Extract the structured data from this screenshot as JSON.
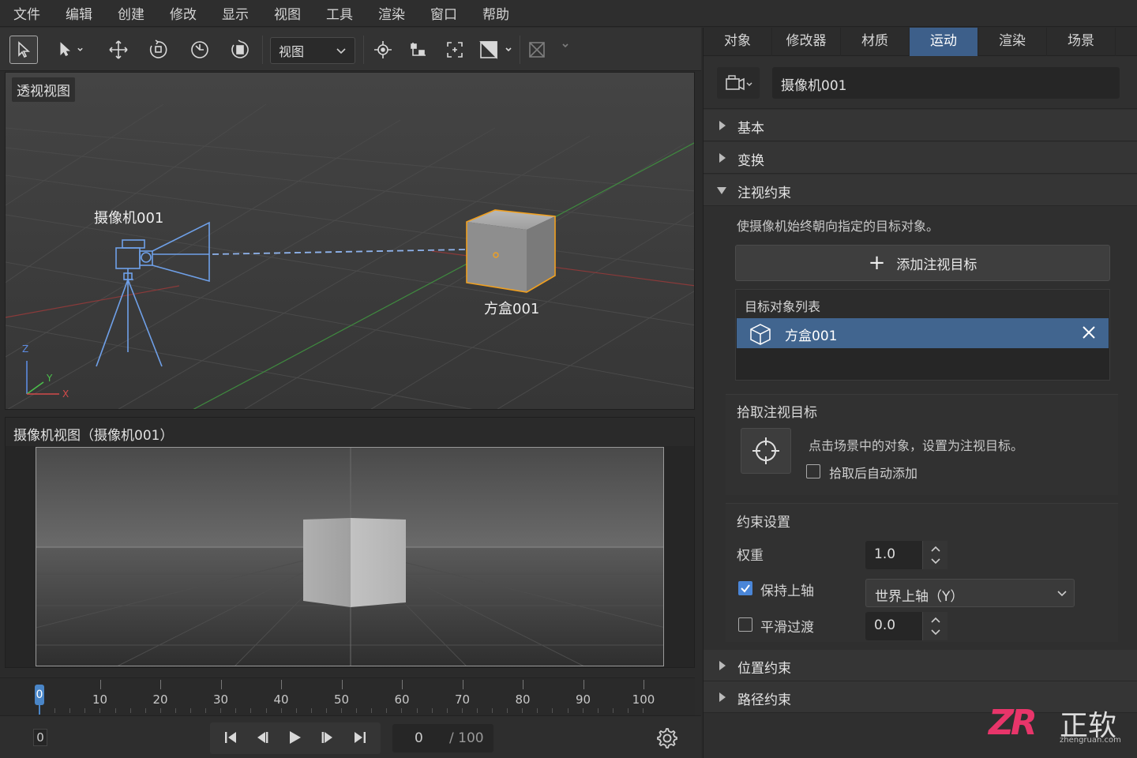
{
  "menu": [
    "文件",
    "编辑",
    "创建",
    "修改",
    "显示",
    "视图",
    "工具",
    "渲染",
    "窗口",
    "帮助"
  ],
  "toolbar": {
    "tools": [
      "select-icon",
      "select-pointer-icon",
      "move-icon",
      "rotate-icon",
      "scale-icon",
      "reset-icon",
      "snap-icon",
      "pivot-icon",
      "fit-icon",
      "shading-icon",
      "maximize-icon"
    ],
    "view_select": "视图"
  },
  "viewport": {
    "persp_label": "透视视图",
    "camera_label": "摄像机001",
    "box_label": "方盒001",
    "axis_labels": {
      "z": "Z",
      "y": "Y",
      "x": "X"
    }
  },
  "camview": {
    "title": "摄像机视图（摄像机001）"
  },
  "timeline": {
    "ticks": [
      "10",
      "20",
      "30",
      "40",
      "50",
      "60",
      "70",
      "80",
      "90",
      "100"
    ],
    "playhead": "0",
    "frame_small": "0",
    "current_frame": "0",
    "total_frames": "/ 100"
  },
  "panel": {
    "tabs": [
      "对象",
      "修改器",
      "材质",
      "运动",
      "渲染",
      "场景"
    ],
    "active_tab": "运动",
    "object_name": "摄像机001",
    "sections": {
      "basic": "基本",
      "transform": "变换",
      "lookat": "注视约束",
      "position": "位置约束",
      "path": "路径约束"
    },
    "lookat": {
      "description": "使摄像机始终朝向指定的目标对象。",
      "add_button": "添加注视目标",
      "list_header": "目标对象列表",
      "targets": [
        "方盒001"
      ],
      "pick_title": "拾取注视目标",
      "pick_desc": "点击场景中的对象，设置为注视目标。",
      "auto_add_label": "拾取后自动添加",
      "auto_add_checked": false,
      "settings_title": "约束设置",
      "weight_label": "权重",
      "weight_value": "1.0",
      "keep_up_label": "保持上轴",
      "keep_up_checked": true,
      "up_axis_value": "世界上轴（Y）",
      "smooth_label": "平滑过渡",
      "smooth_checked": false,
      "smooth_value": "0.0"
    }
  },
  "logo": {
    "mark": "ZR",
    "text": "正软",
    "url": "zhengruan.com"
  },
  "colors": {
    "accent": "#3d5f8a",
    "selection": "#41658f",
    "object_highlight": "#f0a020",
    "camera_wire": "#6fa0e8"
  }
}
